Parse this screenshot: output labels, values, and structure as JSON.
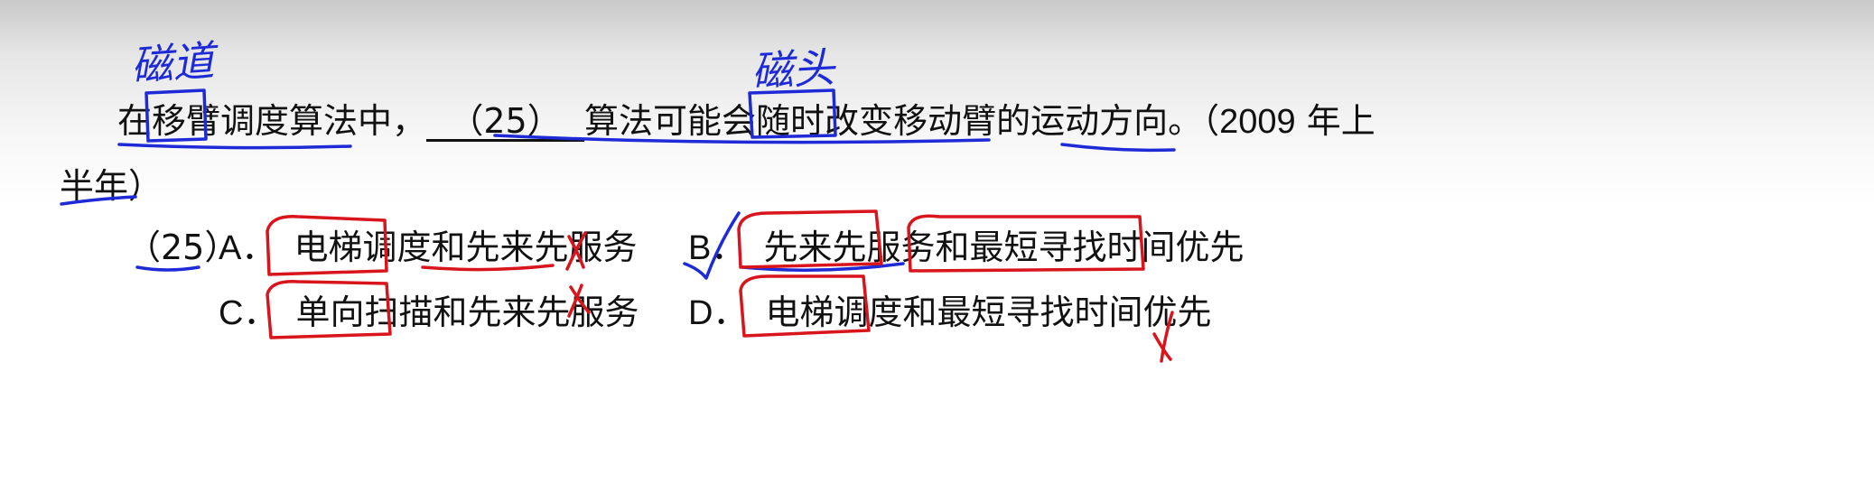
{
  "question": {
    "prefix": "在",
    "term_arm": "移臂",
    "mid": "调度算法中，",
    "blank": "（25）",
    "after_blank": "算法可能会随时改变",
    "term_moving_arm": "移动臂",
    "suffix": "的运动方向。（",
    "year": "2009",
    "year_suffix": " 年上",
    "line2": "半年）"
  },
  "options": {
    "number": "（25）",
    "items": [
      {
        "letter": "A．",
        "text": "电梯调度和先来先服务"
      },
      {
        "letter": "B．",
        "text": "先来先服务和最短寻找时间优先"
      },
      {
        "letter": "C．",
        "text": "单向扫描和先来先服务"
      },
      {
        "letter": "D．",
        "text": "电梯调度和最短寻找时间优先"
      }
    ]
  },
  "handwriting": {
    "note_arm": "磁道",
    "note_head": "磁头",
    "ink_blue": "#1d2ad6",
    "ink_red": "#d8141c"
  }
}
